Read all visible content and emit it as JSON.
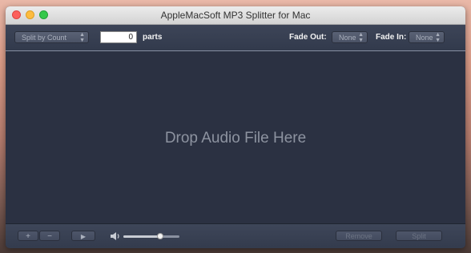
{
  "window": {
    "title": "AppleMacSoft MP3 Splitter for Mac"
  },
  "toolbar": {
    "split_mode": "Split by Count",
    "count_value": "0",
    "parts_label": "parts",
    "fade_out_label": "Fade Out:",
    "fade_out_value": "None",
    "fade_in_label": "Fade In:",
    "fade_in_value": "None"
  },
  "dropzone": {
    "text": "Drop Audio File Here"
  },
  "bottombar": {
    "add_label": "+",
    "remove_item_label": "−",
    "play_label": "▶",
    "volume_level": 0.65,
    "remove_button_label": "Remove",
    "split_button_label": "Split"
  },
  "icons": {
    "speaker": "speaker-icon",
    "popup_arrows": "up-down-arrows-icon"
  }
}
